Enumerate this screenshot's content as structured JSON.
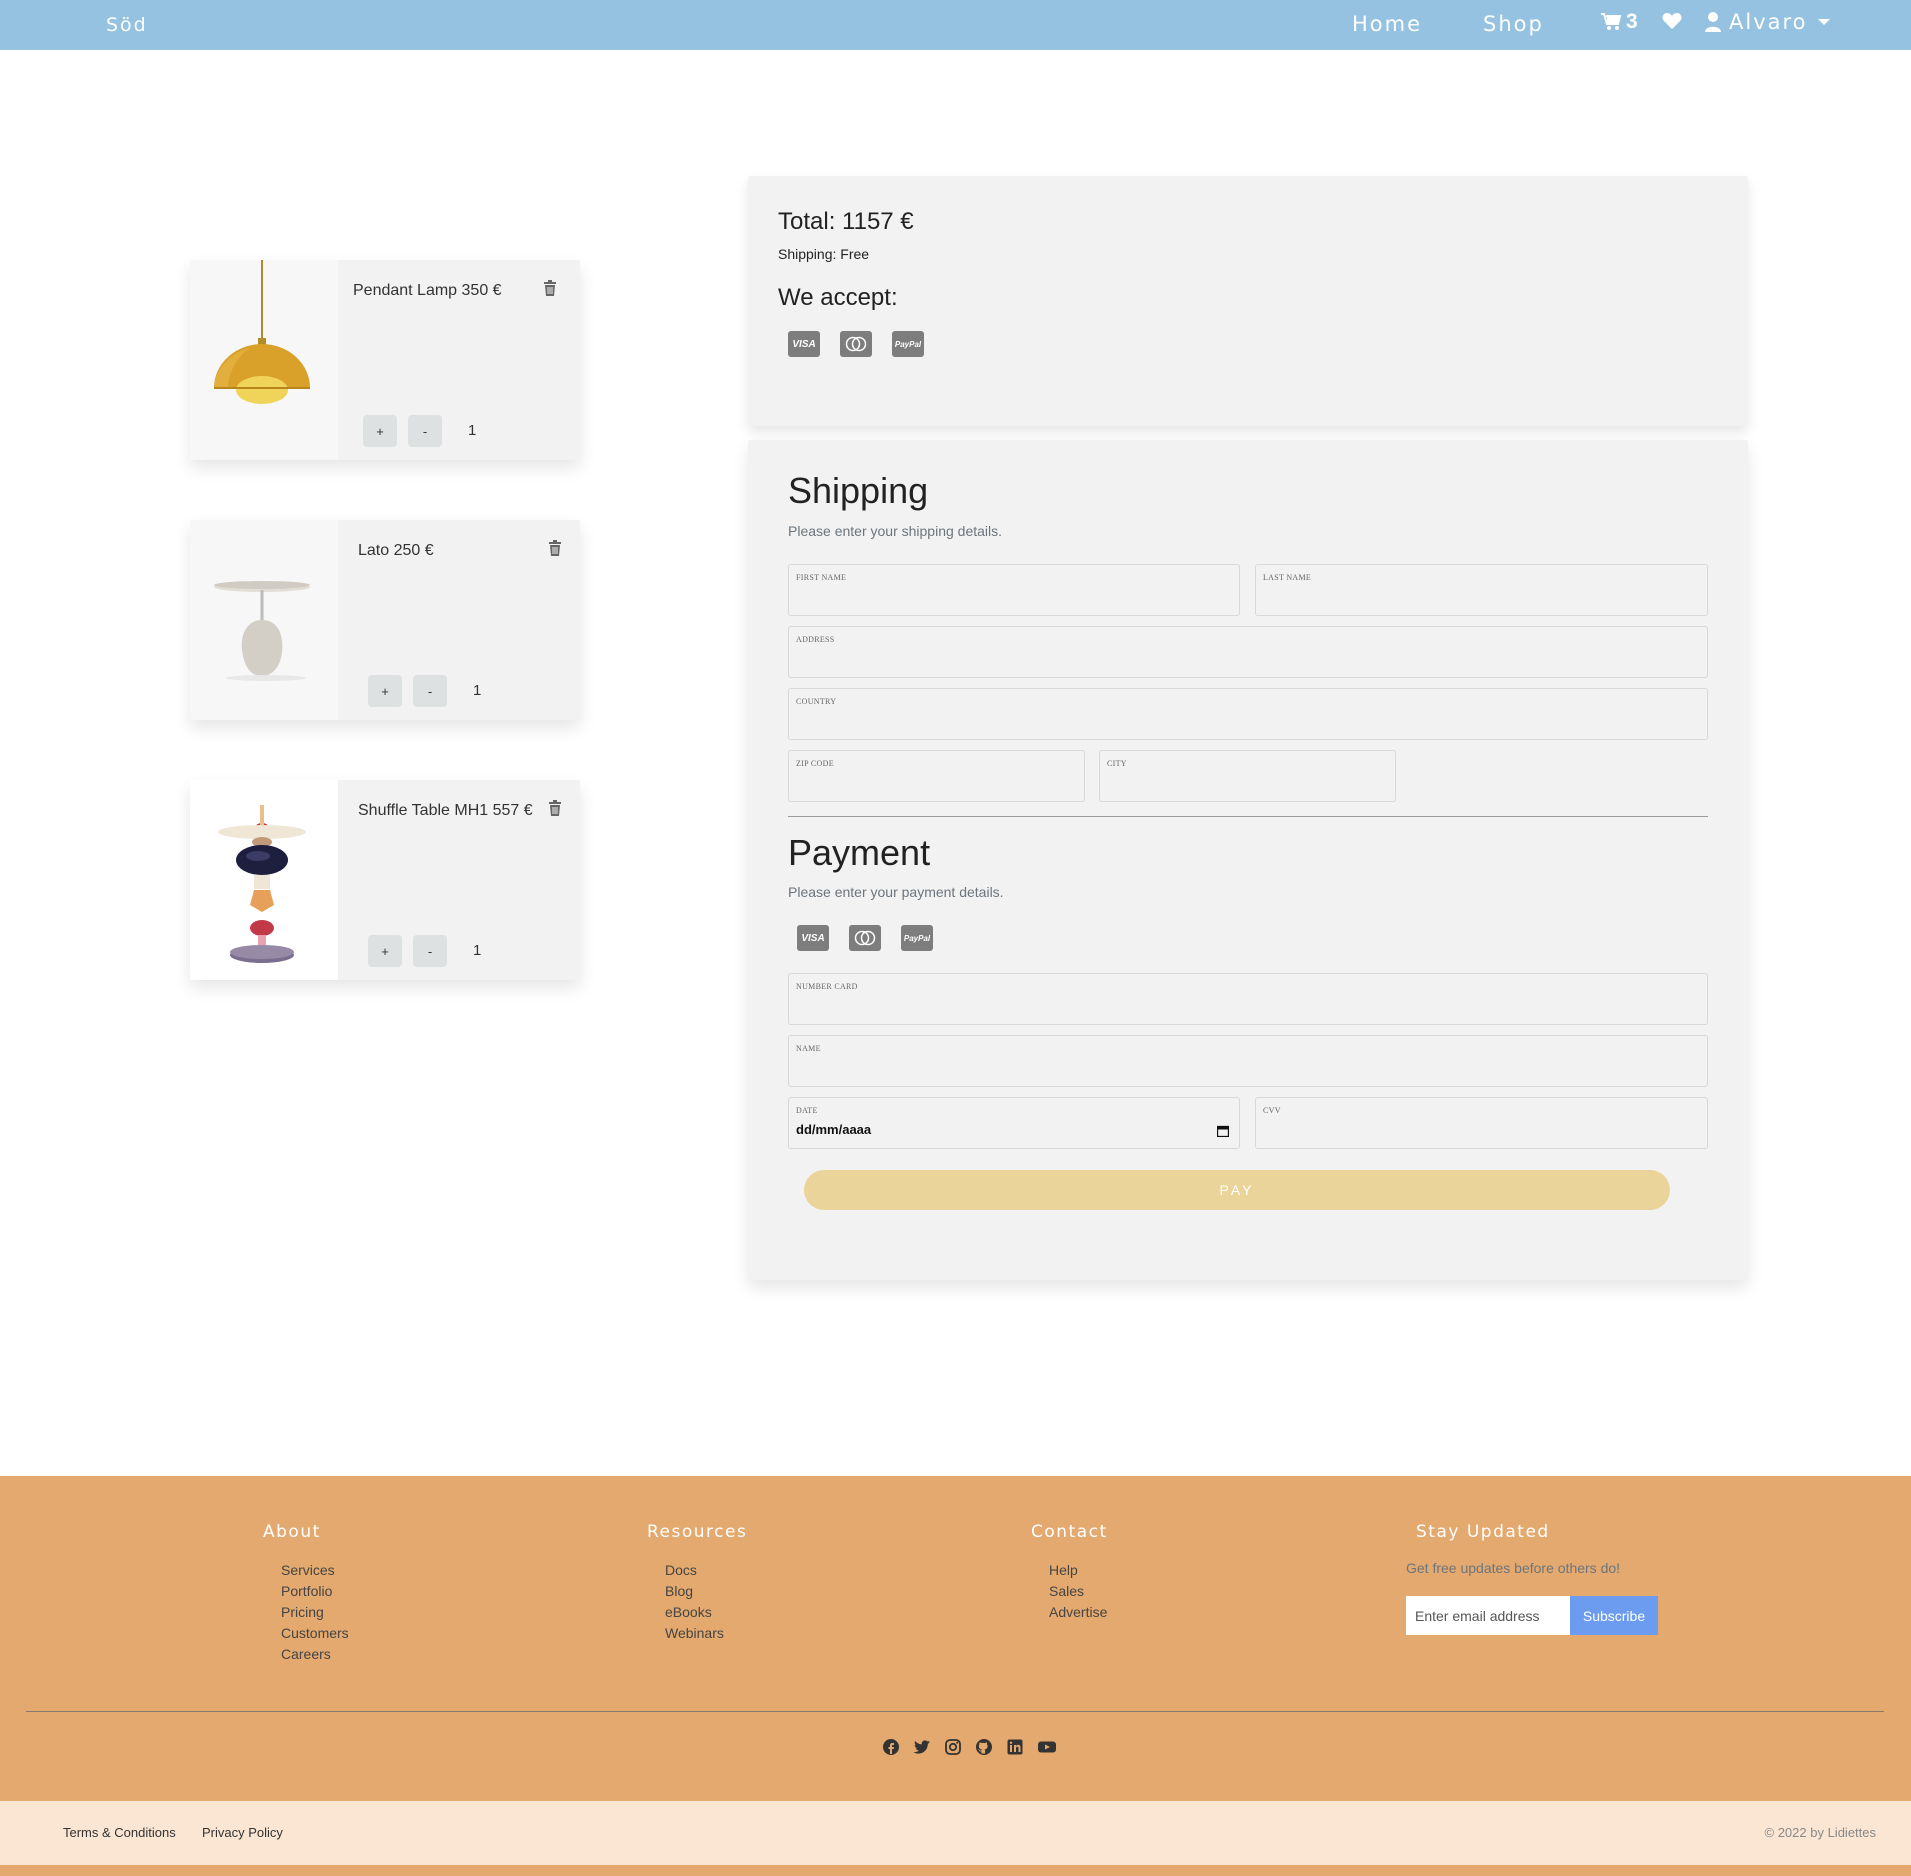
{
  "navbar": {
    "brand": "Söd",
    "home": "Home",
    "shop": "Shop",
    "cart_count": "3",
    "user": "Alvaro"
  },
  "cart": {
    "items": [
      {
        "title": "Pendant Lamp 350 €",
        "quantity": "1",
        "plus": "+",
        "minus": "-"
      },
      {
        "title": "Lato 250 €",
        "quantity": "1",
        "plus": "+",
        "minus": "-"
      },
      {
        "title": "Shuffle Table MH1 557 €",
        "quantity": "1",
        "plus": "+",
        "minus": "-"
      }
    ]
  },
  "summary": {
    "total": "Total: 1157 €",
    "shipping": "Shipping: Free",
    "accept": "We accept:",
    "cards": [
      "VISA",
      "PayPal"
    ]
  },
  "shipping": {
    "title": "Shipping",
    "subtitle": "Please enter your shipping details.",
    "fields": {
      "first_name": "FIRST NAME",
      "last_name": "LAST NAME",
      "address": "ADDRESS",
      "country": "COUNTRY",
      "zip": "ZIP CODE",
      "city": "CITY"
    }
  },
  "payment": {
    "title": "Payment",
    "subtitle": "Please enter your payment details.",
    "fields": {
      "number": "NUMBER CARD",
      "name": "NAME",
      "date": "DATE",
      "date_value": "dd/mm/aaaa",
      "cvv": "CVV"
    },
    "pay_label": "PAY"
  },
  "footer": {
    "about": {
      "title": "About",
      "links": [
        "Services",
        "Portfolio",
        "Pricing",
        "Customers",
        "Careers"
      ]
    },
    "resources": {
      "title": "Resources",
      "links": [
        "Docs",
        "Blog",
        "eBooks",
        "Webinars"
      ]
    },
    "contact": {
      "title": "Contact",
      "links": [
        "Help",
        "Sales",
        "Advertise"
      ]
    },
    "updates": {
      "title": "Stay Updated",
      "note": "Get free updates before others do!",
      "email_placeholder": "Enter email address",
      "subscribe": "Subscribe"
    },
    "terms": "Terms & Conditions",
    "privacy": "Privacy Policy",
    "copyright": "© 2022 by Lidiettes"
  },
  "colors": {
    "navbar": "#94c2e0",
    "footer": "#e4a96e",
    "pay_button": "#ebd49a",
    "subscribe": "#6b9cf0"
  }
}
